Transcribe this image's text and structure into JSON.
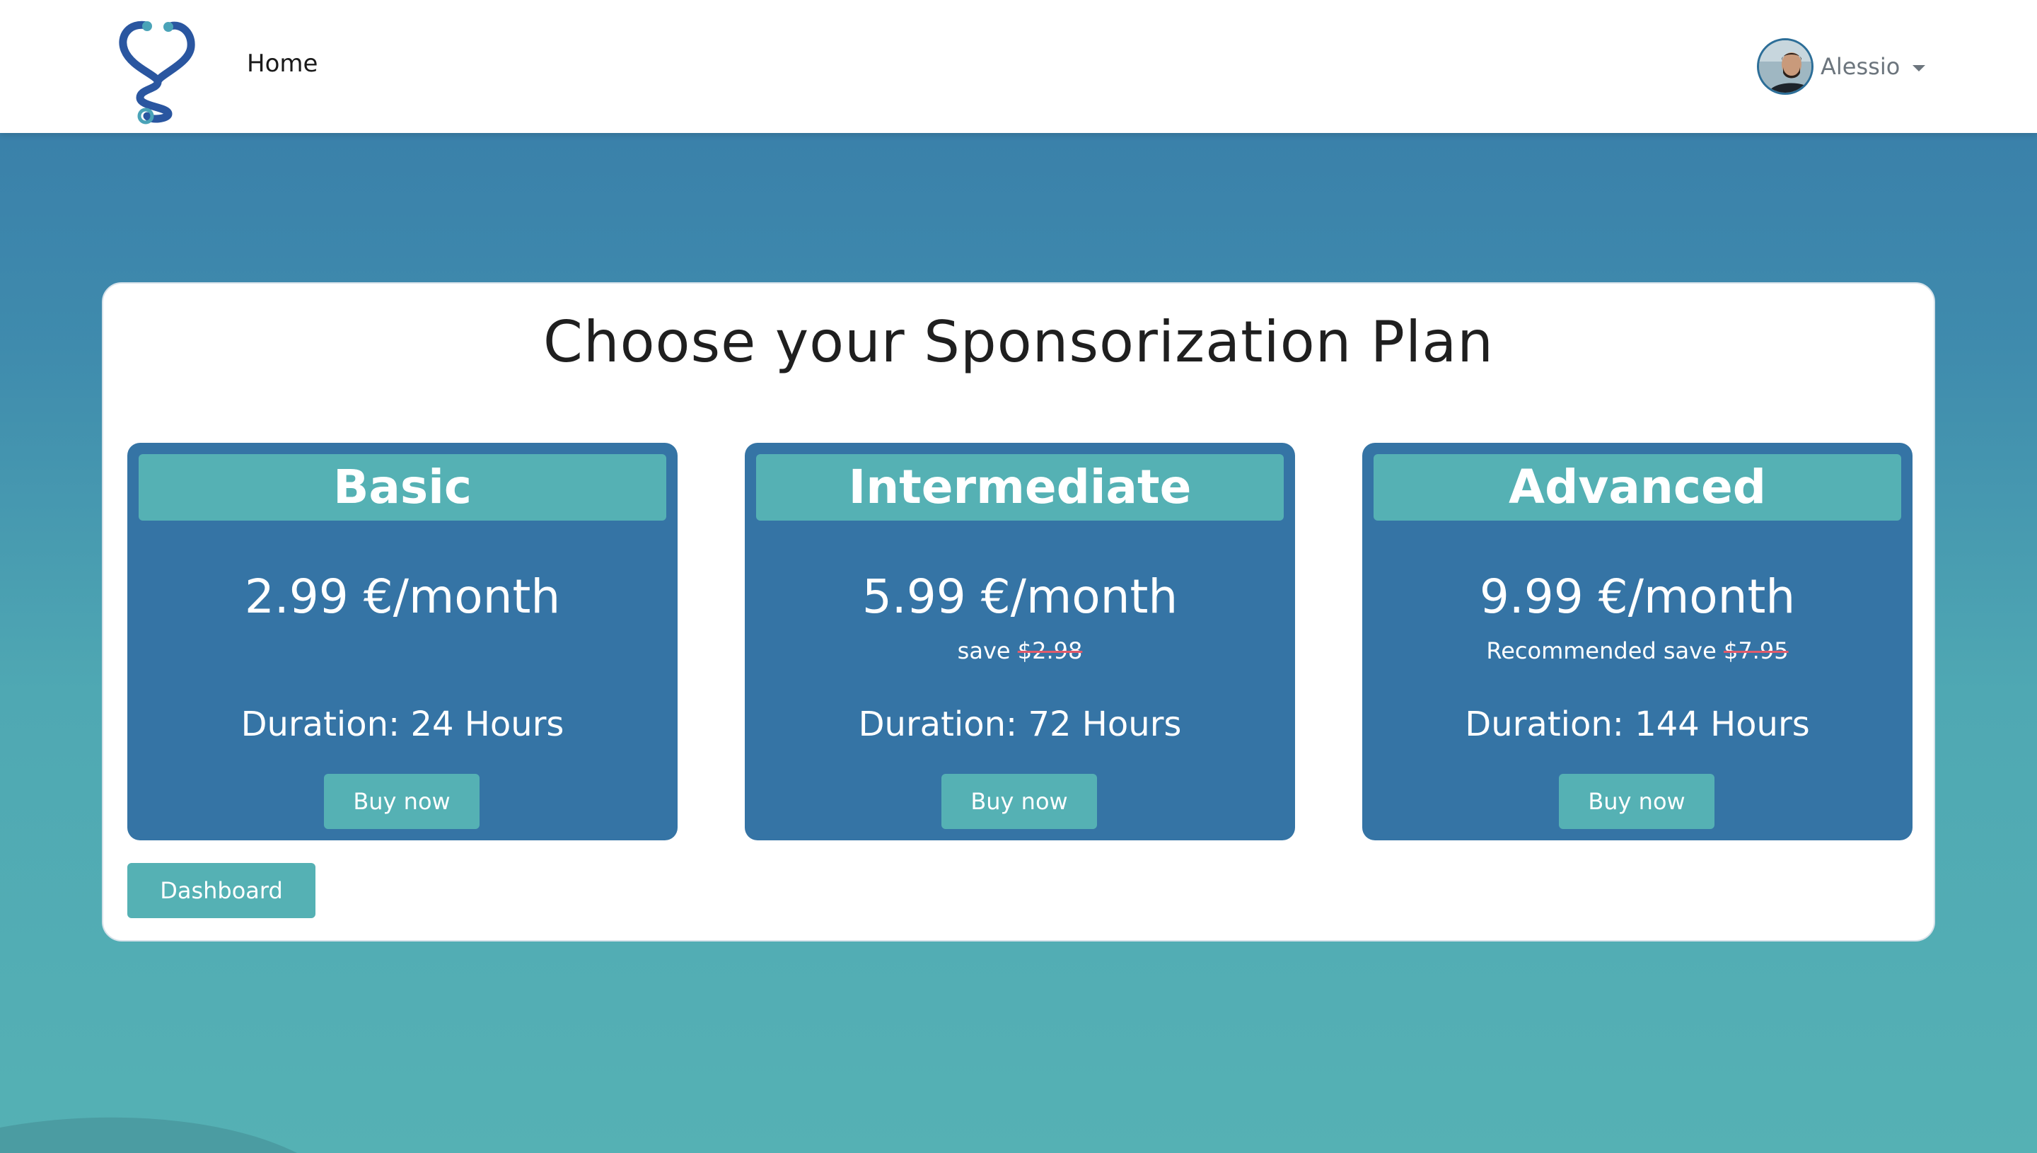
{
  "navbar": {
    "logo_icon": "stethoscope-heart-icon",
    "home_label": "Home",
    "user": {
      "name": "Alessio",
      "avatar": "user-avatar-photo"
    }
  },
  "main": {
    "title": "Choose your Sponsorization Plan",
    "plans": [
      {
        "name": "Basic",
        "price": "2.99 €/month",
        "save_prefix": "",
        "save_amount": "",
        "duration": "Duration: 24 Hours",
        "button": "Buy now"
      },
      {
        "name": "Intermediate",
        "price": "5.99 €/month",
        "save_prefix": "save ",
        "save_amount": "$2.98",
        "duration": "Duration: 72 Hours",
        "button": "Buy now"
      },
      {
        "name": "Advanced",
        "price": "9.99 €/month",
        "save_prefix": "Recommended save ",
        "save_amount": "$7.95",
        "duration": "Duration: 144 Hours",
        "button": "Buy now"
      }
    ],
    "dashboard_button": "Dashboard"
  },
  "colors": {
    "card_bg": "#3574a5",
    "accent": "#55b1b4",
    "background_top": "#377aa8",
    "background_bottom": "#55b1b4",
    "strike": "#e05a6b"
  }
}
